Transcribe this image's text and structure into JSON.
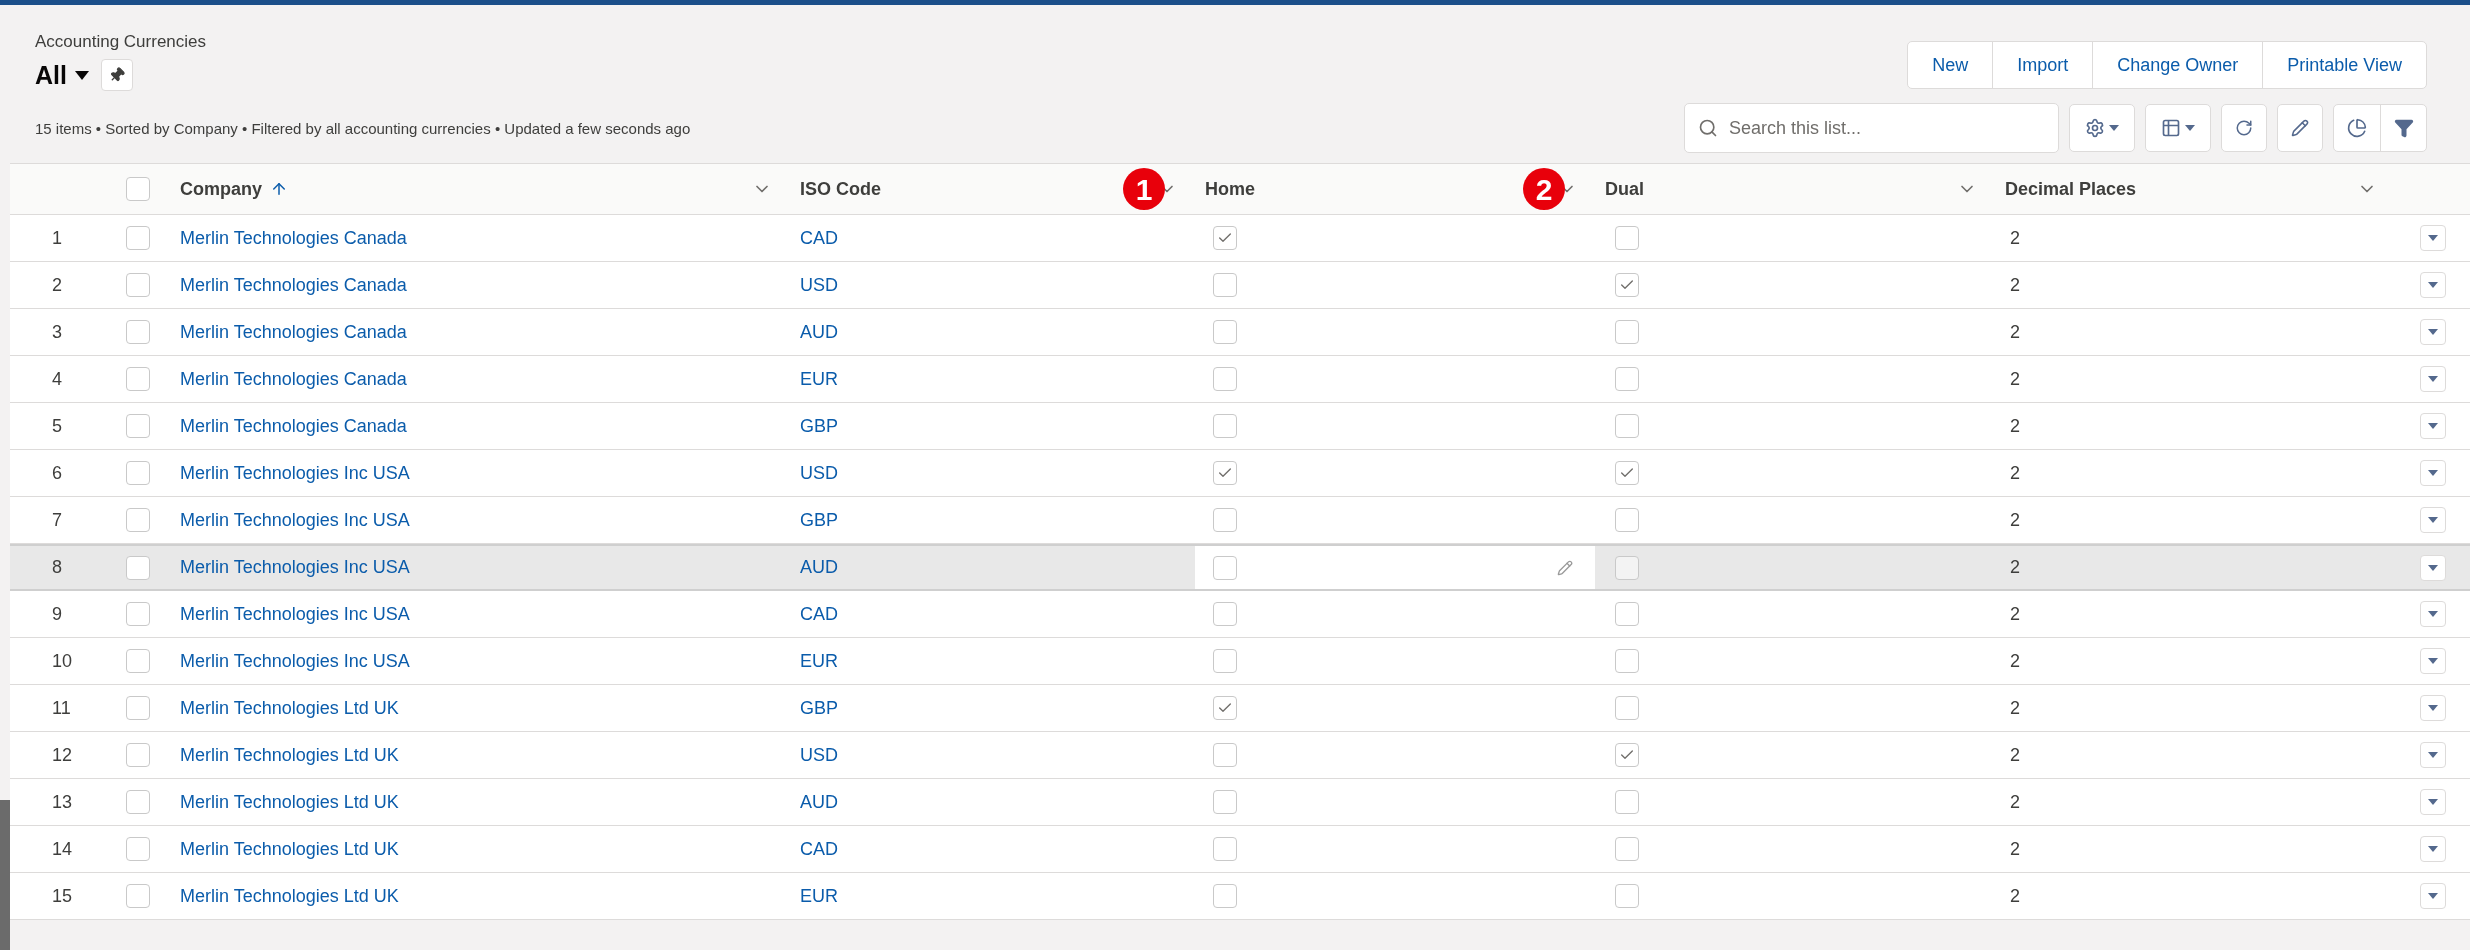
{
  "header": {
    "object_name": "Accounting Currencies",
    "list_view": "All",
    "status": "15 items • Sorted by Company • Filtered by all accounting currencies • Updated a few seconds ago"
  },
  "actions": [
    "New",
    "Import",
    "Change Owner",
    "Printable View"
  ],
  "search": {
    "placeholder": "Search this list..."
  },
  "table": {
    "select_all": false,
    "columns": [
      {
        "label": "Company",
        "sorted": true
      },
      {
        "label": "ISO Code",
        "sorted": false,
        "annotation": "1"
      },
      {
        "label": "Home",
        "sorted": false,
        "annotation": "2"
      },
      {
        "label": "Dual",
        "sorted": false
      },
      {
        "label": "Decimal Places",
        "sorted": false
      }
    ],
    "rows": [
      {
        "number": "1",
        "selected": false,
        "company": "Merlin Technologies Canada",
        "iso_code": "CAD",
        "home": true,
        "dual": false,
        "decimal_places": "2",
        "hovered": false
      },
      {
        "number": "2",
        "selected": false,
        "company": "Merlin Technologies Canada",
        "iso_code": "USD",
        "home": false,
        "dual": true,
        "decimal_places": "2",
        "hovered": false
      },
      {
        "number": "3",
        "selected": false,
        "company": "Merlin Technologies Canada",
        "iso_code": "AUD",
        "home": false,
        "dual": false,
        "decimal_places": "2",
        "hovered": false
      },
      {
        "number": "4",
        "selected": false,
        "company": "Merlin Technologies Canada",
        "iso_code": "EUR",
        "home": false,
        "dual": false,
        "decimal_places": "2",
        "hovered": false
      },
      {
        "number": "5",
        "selected": false,
        "company": "Merlin Technologies Canada",
        "iso_code": "GBP",
        "home": false,
        "dual": false,
        "decimal_places": "2",
        "hovered": false
      },
      {
        "number": "6",
        "selected": false,
        "company": "Merlin Technologies Inc USA",
        "iso_code": "USD",
        "home": true,
        "dual": true,
        "decimal_places": "2",
        "hovered": false
      },
      {
        "number": "7",
        "selected": false,
        "company": "Merlin Technologies Inc USA",
        "iso_code": "GBP",
        "home": false,
        "dual": false,
        "decimal_places": "2",
        "hovered": false
      },
      {
        "number": "8",
        "selected": false,
        "company": "Merlin Technologies Inc USA",
        "iso_code": "AUD",
        "home": false,
        "dual": false,
        "decimal_places": "2",
        "hovered": true
      },
      {
        "number": "9",
        "selected": false,
        "company": "Merlin Technologies Inc USA",
        "iso_code": "CAD",
        "home": false,
        "dual": false,
        "decimal_places": "2",
        "hovered": false
      },
      {
        "number": "10",
        "selected": false,
        "company": "Merlin Technologies Inc USA",
        "iso_code": "EUR",
        "home": false,
        "dual": false,
        "decimal_places": "2",
        "hovered": false
      },
      {
        "number": "11",
        "selected": false,
        "company": "Merlin Technologies Ltd UK",
        "iso_code": "GBP",
        "home": true,
        "dual": false,
        "decimal_places": "2",
        "hovered": false
      },
      {
        "number": "12",
        "selected": false,
        "company": "Merlin Technologies Ltd UK",
        "iso_code": "USD",
        "home": false,
        "dual": true,
        "decimal_places": "2",
        "hovered": false
      },
      {
        "number": "13",
        "selected": false,
        "company": "Merlin Technologies Ltd UK",
        "iso_code": "AUD",
        "home": false,
        "dual": false,
        "decimal_places": "2",
        "hovered": false
      },
      {
        "number": "14",
        "selected": false,
        "company": "Merlin Technologies Ltd UK",
        "iso_code": "CAD",
        "home": false,
        "dual": false,
        "decimal_places": "2",
        "hovered": false
      },
      {
        "number": "15",
        "selected": false,
        "company": "Merlin Technologies Ltd UK",
        "iso_code": "EUR",
        "home": false,
        "dual": false,
        "decimal_places": "2",
        "hovered": false
      }
    ]
  }
}
